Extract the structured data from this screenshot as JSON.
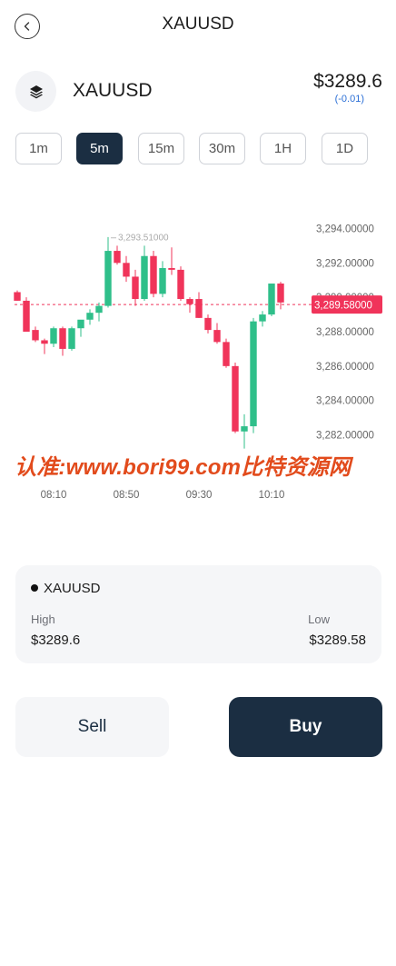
{
  "header": {
    "title": "XAUUSD",
    "back_icon": "chevron-left-icon"
  },
  "asset": {
    "icon": "layers-icon",
    "name": "XAUUSD",
    "price": "$3289.6",
    "change": "(-0.01)"
  },
  "timeframes": [
    {
      "label": "1m",
      "active": false
    },
    {
      "label": "5m",
      "active": true
    },
    {
      "label": "15m",
      "active": false
    },
    {
      "label": "30m",
      "active": false
    },
    {
      "label": "1H",
      "active": false
    },
    {
      "label": "1D",
      "active": false
    }
  ],
  "chart_data": {
    "type": "candlestick",
    "y_ticks": [
      "3,294.00000",
      "3,292.00000",
      "3,290.00000",
      "3,288.00000",
      "3,286.00000",
      "3,284.00000",
      "3,282.00000"
    ],
    "ylim": [
      3281.5,
      3294.5
    ],
    "x_ticks": [
      {
        "label": "08:10",
        "index": 4
      },
      {
        "label": "08:50",
        "index": 12
      },
      {
        "label": "09:30",
        "index": 20
      },
      {
        "label": "10:10",
        "index": 28
      }
    ],
    "high_marker": {
      "label": "3,293.51000",
      "value": 3293.51,
      "index": 10
    },
    "current_price": {
      "label": "3,289.58000",
      "value": 3289.58
    },
    "colors": {
      "up": "#2fbf8a",
      "down": "#f0345a",
      "price_line": "#f0345a",
      "price_tag": "#f0345a"
    },
    "candles": [
      {
        "o": 3290.3,
        "h": 3290.4,
        "l": 3289.8,
        "c": 3289.8
      },
      {
        "o": 3289.8,
        "h": 3290.0,
        "l": 3288.0,
        "c": 3288.0
      },
      {
        "o": 3288.1,
        "h": 3288.3,
        "l": 3287.4,
        "c": 3287.5
      },
      {
        "o": 3287.5,
        "h": 3287.6,
        "l": 3286.7,
        "c": 3287.3
      },
      {
        "o": 3287.3,
        "h": 3288.3,
        "l": 3287.1,
        "c": 3288.2
      },
      {
        "o": 3288.2,
        "h": 3288.3,
        "l": 3286.6,
        "c": 3287.0
      },
      {
        "o": 3287.0,
        "h": 3288.3,
        "l": 3286.9,
        "c": 3288.2
      },
      {
        "o": 3288.2,
        "h": 3288.6,
        "l": 3287.7,
        "c": 3288.7
      },
      {
        "o": 3288.7,
        "h": 3289.3,
        "l": 3288.4,
        "c": 3289.1
      },
      {
        "o": 3289.1,
        "h": 3289.7,
        "l": 3288.6,
        "c": 3289.5
      },
      {
        "o": 3289.5,
        "h": 3293.5,
        "l": 3289.4,
        "c": 3292.7
      },
      {
        "o": 3292.7,
        "h": 3293.0,
        "l": 3291.9,
        "c": 3292.0
      },
      {
        "o": 3292.0,
        "h": 3292.4,
        "l": 3290.9,
        "c": 3291.2
      },
      {
        "o": 3291.2,
        "h": 3291.6,
        "l": 3289.5,
        "c": 3289.9
      },
      {
        "o": 3289.9,
        "h": 3293.0,
        "l": 3289.8,
        "c": 3292.4
      },
      {
        "o": 3292.4,
        "h": 3292.7,
        "l": 3290.0,
        "c": 3290.2
      },
      {
        "o": 3290.2,
        "h": 3292.1,
        "l": 3290.0,
        "c": 3291.7
      },
      {
        "o": 3291.7,
        "h": 3292.9,
        "l": 3291.3,
        "c": 3291.6
      },
      {
        "o": 3291.6,
        "h": 3291.8,
        "l": 3289.8,
        "c": 3289.9
      },
      {
        "o": 3289.9,
        "h": 3290.0,
        "l": 3289.1,
        "c": 3289.6
      },
      {
        "o": 3289.9,
        "h": 3290.3,
        "l": 3288.8,
        "c": 3288.8
      },
      {
        "o": 3288.8,
        "h": 3289.0,
        "l": 3287.9,
        "c": 3288.1
      },
      {
        "o": 3288.1,
        "h": 3288.5,
        "l": 3287.3,
        "c": 3287.4
      },
      {
        "o": 3287.4,
        "h": 3287.6,
        "l": 3285.9,
        "c": 3286.0
      },
      {
        "o": 3286.0,
        "h": 3286.2,
        "l": 3282.1,
        "c": 3282.2
      },
      {
        "o": 3282.2,
        "h": 3283.2,
        "l": 3281.2,
        "c": 3282.5
      },
      {
        "o": 3282.5,
        "h": 3288.8,
        "l": 3282.1,
        "c": 3288.6
      },
      {
        "o": 3288.6,
        "h": 3289.2,
        "l": 3288.3,
        "c": 3289.0
      },
      {
        "o": 3289.0,
        "h": 3290.8,
        "l": 3288.9,
        "c": 3290.8
      },
      {
        "o": 3290.8,
        "h": 3290.9,
        "l": 3289.3,
        "c": 3289.7
      }
    ]
  },
  "watermark": "认准:www.bori99.com比特资源网",
  "info_card": {
    "symbol": "XAUUSD",
    "high_label": "High",
    "high_value": "$3289.6",
    "low_label": "Low",
    "low_value": "$3289.58"
  },
  "actions": {
    "sell_label": "Sell",
    "buy_label": "Buy"
  }
}
